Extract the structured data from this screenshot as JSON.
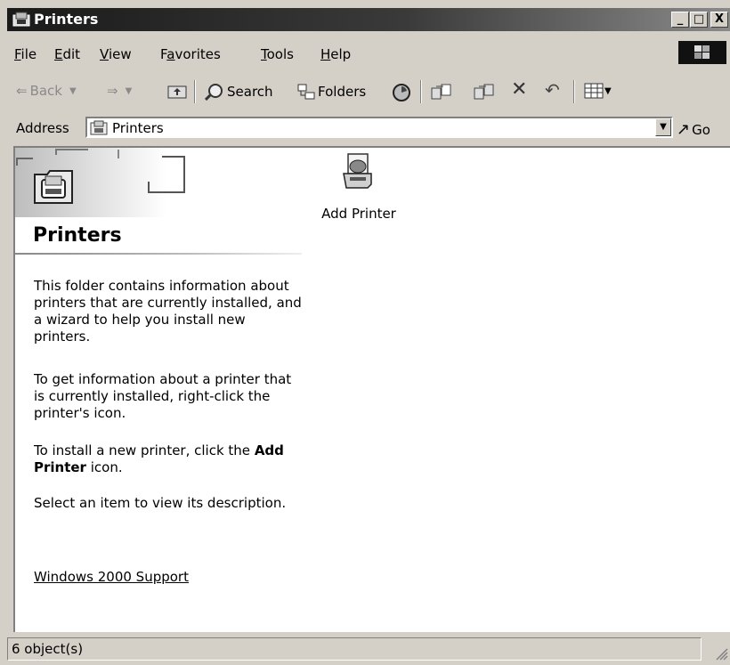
{
  "window": {
    "title": "Printers"
  },
  "caption_buttons": {
    "minimize": "_",
    "maximize": "□",
    "close": "X"
  },
  "menu": [
    "File",
    "Edit",
    "View",
    "Favorites",
    "Tools",
    "Help"
  ],
  "menu_underline": [
    "F",
    "E",
    "V",
    "a",
    "T",
    "H"
  ],
  "toolbar": {
    "back": "Back",
    "search": "Search",
    "folders": "Folders"
  },
  "address": {
    "label": "Address",
    "value": "Printers",
    "go": "Go"
  },
  "panel": {
    "title": "Printers",
    "p1": "This folder contains information about printers that are currently installed, and a wizard to help you install new printers.",
    "p2": "To get information about a printer that is currently installed, right-click the printer's icon.",
    "p3_pre": "To install a new printer, click the ",
    "p3_bold": "Add Printer",
    "p3_post": " icon.",
    "p4": "Select an item to view its description.",
    "support_link": "Windows 2000 Support"
  },
  "items": [
    {
      "label": "Add Printer",
      "icon": "add-printer-icon"
    }
  ],
  "status": {
    "text": "6 object(s)"
  }
}
